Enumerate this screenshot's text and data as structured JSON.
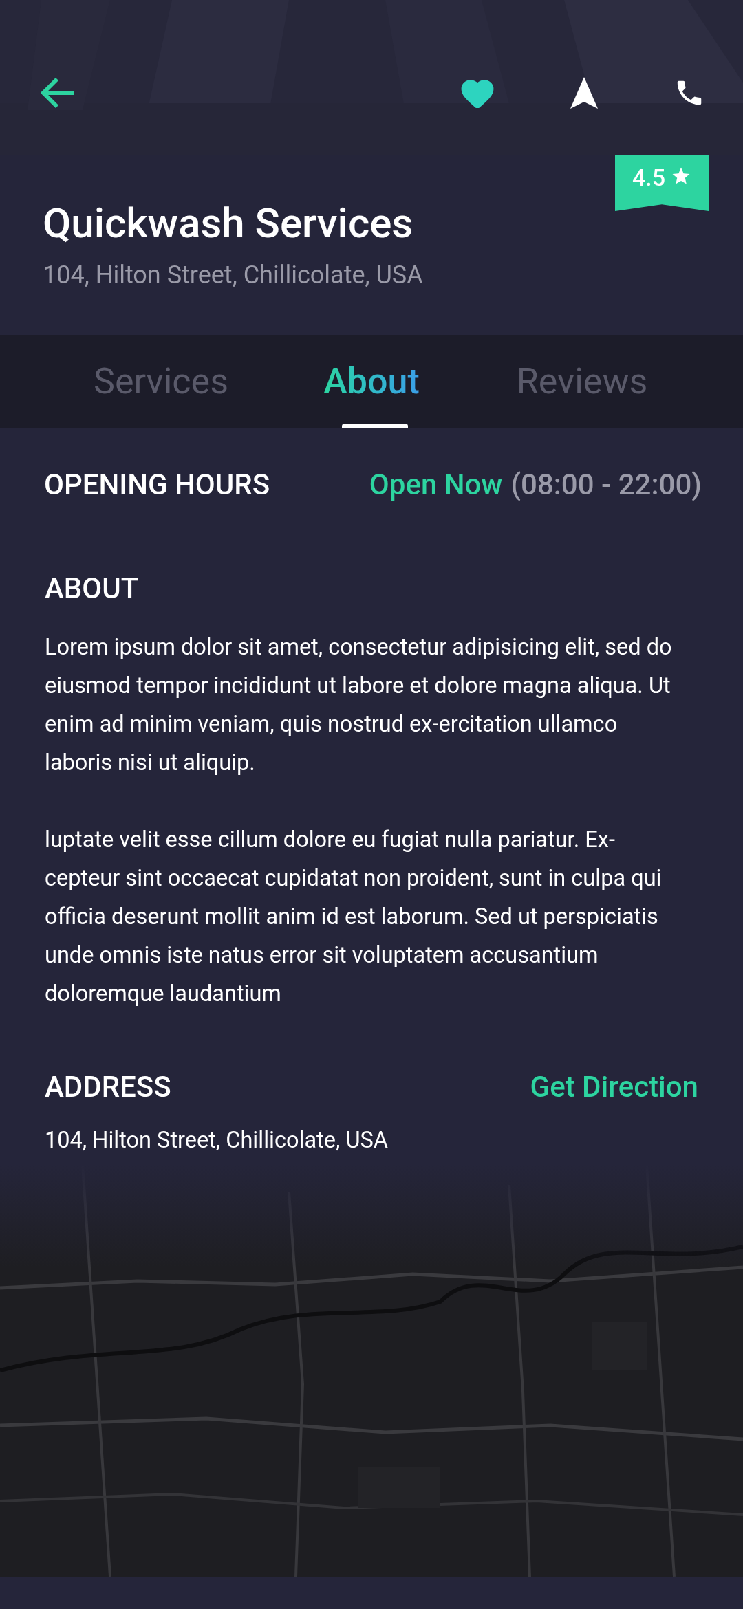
{
  "header": {
    "kind": "picture",
    "rating": "4.5",
    "favorite": true
  },
  "business": {
    "name": "Quickwash Services",
    "address": "104, Hilton Street, Chillicolate, USA"
  },
  "tabs": [
    {
      "label": "Services",
      "selected": false
    },
    {
      "label": "About",
      "selected": true
    },
    {
      "label": "Reviews",
      "selected": false
    }
  ],
  "opening_hours": {
    "label": "OPENING HOURS",
    "status": "Open Now",
    "hours": "(08:00 - 22:00)"
  },
  "about": {
    "heading": "ABOUT",
    "paragraphs": [
      "Lorem ipsum dolor sit amet, consectetur adipisicing elit, sed do eiusmod tempor incididunt ut labore et dolore magna aliqua. Ut enim ad minim veniam, quis nostrud ex-ercitation ullamco laboris nisi ut aliquip.",
      "luptate velit esse cillum dolore eu fugiat nulla pariatur. Ex-cepteur sint occaecat cupidatat non proident, sunt in culpa qui officia deserunt mollit anim id est laborum. Sed ut perspiciatis unde omnis iste natus error sit voluptatem accusantium doloremque laudantium"
    ]
  },
  "address": {
    "heading": "ADDRESS",
    "link": "Get Direction",
    "text": "104, Hilton Street, Chillicolate, USA"
  }
}
